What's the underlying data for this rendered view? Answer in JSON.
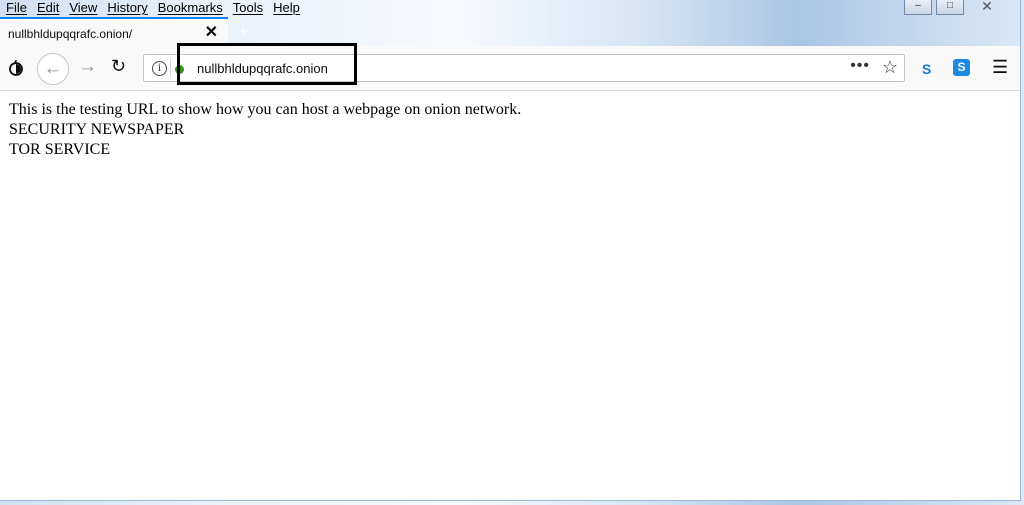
{
  "menu": [
    "File",
    "Edit",
    "View",
    "History",
    "Bookmarks",
    "Tools",
    "Help"
  ],
  "window_controls": [
    "minimize",
    "maximize",
    "close"
  ],
  "tab": {
    "title": "nullbhldupqqrafc.onion/",
    "close_symbol": "✕",
    "new_tab_symbol": "+"
  },
  "navbar": {
    "onion_icon": "onion-icon",
    "back_symbol": "←",
    "forward_symbol": "→",
    "reload_symbol": "↻",
    "info_symbol": "i",
    "url": "nullbhldupqqrafc.onion",
    "more_symbol": "•••",
    "star_symbol": "☆",
    "ext1": "S",
    "ext2": "S",
    "menu_symbol": "☰"
  },
  "page": {
    "lines": [
      "This is the testing URL to show how you can host a webpage on onion network.",
      "SECURITY NEWSPAPER",
      "TOR SERVICE"
    ]
  },
  "colors": {
    "accent": "#0a84ff",
    "secure_dot": "#3b8c1e",
    "highlight": "#000000"
  }
}
